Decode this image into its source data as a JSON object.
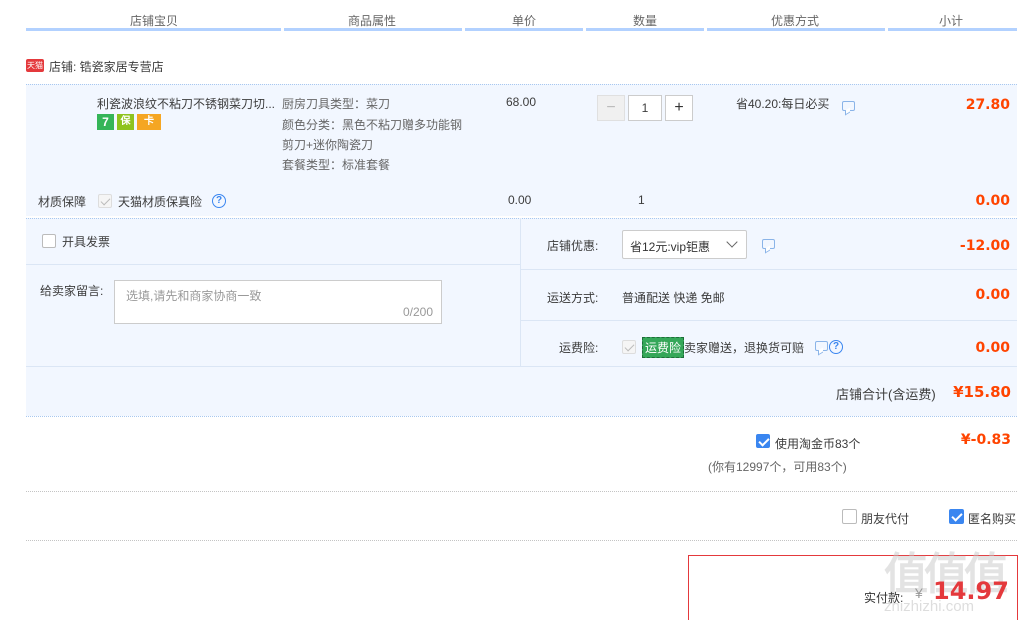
{
  "header": {
    "col_item": "店铺宝贝",
    "col_attr": "商品属性",
    "col_price": "单价",
    "col_qty": "数量",
    "col_discount": "优惠方式",
    "col_subtotal": "小计"
  },
  "shop": {
    "badge": "天猫",
    "name": "店铺: 锆瓷家居专营店"
  },
  "product": {
    "title": "利瓷波浪纹不粘刀不锈钢菜刀切...",
    "badges": [
      "7",
      "保",
      "卡"
    ],
    "attr1": "厨房刀具类型：菜刀",
    "attr2": "颜色分类：黑色不粘刀赠多功能钢",
    "attr3": "剪刀+迷你陶瓷刀",
    "attr4": "套餐类型：标准套餐",
    "price": "68.00",
    "qty": "1",
    "qty_minus": "−",
    "qty_plus": "+",
    "discount": "省40.20:每日必买",
    "subtotal": "27.80"
  },
  "insurance": {
    "label": "材质保障",
    "option": "天猫材质保真险",
    "price": "0.00",
    "qty": "1",
    "subtotal": "0.00"
  },
  "invoice": {
    "label": "开具发票"
  },
  "message": {
    "label": "给卖家留言:",
    "placeholder": "选填,请先和商家协商一致",
    "counter": "0/200"
  },
  "shop_discount": {
    "label": "店铺优惠:",
    "value": "省12元:vip钜惠",
    "amount": "-12.00"
  },
  "shipping": {
    "label": "运送方式:",
    "value": "普通配送 快递 免邮",
    "amount": "0.00"
  },
  "freight_insurance": {
    "label": "运费险:",
    "tag": "运费险",
    "desc": "卖家赠送，退换货可赔",
    "amount": "0.00"
  },
  "shop_total": {
    "label": "店铺合计(含运费)",
    "amount": "¥15.80"
  },
  "coins": {
    "label": "使用淘金币83个",
    "sub": "(你有12997个，可用83个)",
    "amount": "¥-0.83"
  },
  "options": {
    "friend_pay": "朋友代付",
    "anonymous": "匿名购买"
  },
  "pay": {
    "label": "实付款:",
    "currency": "¥",
    "amount": "14.97"
  },
  "watermark": {
    "big": "值值值",
    "small": "zhizhizhi.com"
  },
  "colors": {
    "accent": "#3a86f0",
    "price_red": "#e4393c",
    "panel_bg": "#f2f7ff",
    "header_bar": "#b2d1ff"
  }
}
